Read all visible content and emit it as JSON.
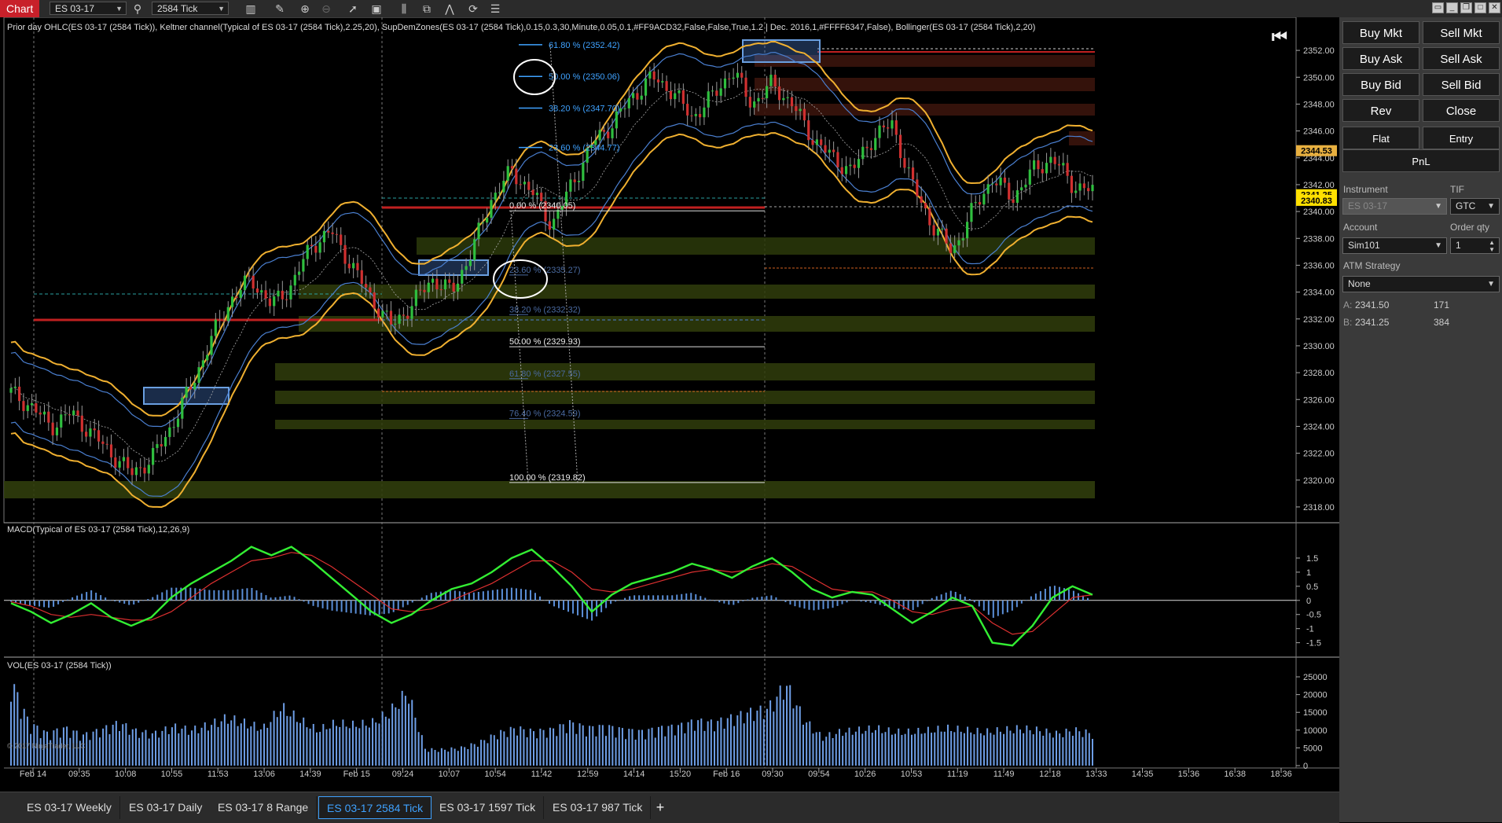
{
  "toolbar": {
    "title": "Chart",
    "instrument": "ES 03-17",
    "bar_type": "2584 Tick"
  },
  "chart_titles": {
    "price_panel": "Prior day OHLC(ES 03-17 (2584 Tick)), Keltner channel(Typical of ES 03-17 (2584 Tick),2.25,20), SupDemZones(ES 03-17 (2584 Tick),0.15,0.3,30,Minute,0.05,0.1,#FF9ACD32,False,False,True,1.2 | Dec. 2016,1,#FFFF6347,False), Bollinger(ES 03-17 (2584 Tick),2,20)",
    "macd_panel": "MACD(Typical of ES 03-17 (2584 Tick),12,26,9)",
    "vol_panel": "VOL(ES 03-17 (2584 Tick))",
    "copyright": "© 2017 NinjaTrader, LLC"
  },
  "chart_data": [
    {
      "type": "line",
      "panel": "price",
      "ylim": [
        2317.0,
        2353.0
      ],
      "y_ticks": [
        "2352.00",
        "2350.00",
        "2348.00",
        "2346.00",
        "2344.00",
        "2342.00",
        "2340.00",
        "2338.00",
        "2336.00",
        "2334.00",
        "2332.00",
        "2330.00",
        "2328.00",
        "2326.00",
        "2324.00",
        "2322.00",
        "2320.00",
        "2318.00"
      ],
      "x_ticks": [
        "Feb 14",
        "09:35",
        "10:08",
        "10:55",
        "11:53",
        "13:06",
        "14:39",
        "Feb 15",
        "09:24",
        "10:07",
        "10:54",
        "11:42",
        "12:59",
        "14:14",
        "15:20",
        "Feb 16",
        "09:30",
        "09:54",
        "10:26",
        "10:53",
        "11:19",
        "11:49",
        "12:18",
        "13:33",
        "14:35",
        "15:36",
        "16:38",
        "18:36"
      ],
      "series": [
        {
          "values": [
            2326.5,
            2325.5,
            2324.0,
            2325.0,
            2323.5,
            2322.0,
            2320.5,
            2321.5,
            2324.0,
            2327.0,
            2330.5,
            2333.5,
            2335.0,
            2333.0,
            2334.5,
            2337.5,
            2338.5,
            2336.0,
            2333.5,
            2331.5,
            2333.0,
            2335.0,
            2334.0,
            2337.0,
            2341.0,
            2343.0,
            2341.5,
            2339.0,
            2342.0,
            2345.0,
            2346.5,
            2348.5,
            2350.0,
            2349.0,
            2347.0,
            2348.5,
            2350.5,
            2348.0,
            2349.5,
            2348.0,
            2345.5,
            2344.0,
            2343.0,
            2345.5,
            2346.5,
            2342.0,
            2339.0,
            2337.0,
            2340.0,
            2342.5,
            2341.0,
            2343.0,
            2344.0,
            2342.0,
            2341.5
          ]
        }
      ],
      "price_markers": [
        {
          "label": "2344.53",
          "value": 2344.53,
          "color": "#e8b040"
        },
        {
          "label": "2341.25",
          "value": 2341.25,
          "color": "#ffe000"
        },
        {
          "label": "2340.83",
          "value": 2340.83,
          "color": "#ffe000"
        }
      ],
      "fibonacci_upper": [
        {
          "label": "61.80 % (2352.42)",
          "value": 2352.42
        },
        {
          "label": "50.00 % (2350.06)",
          "value": 2350.06
        },
        {
          "label": "38.20 % (2347.70)",
          "value": 2347.7
        },
        {
          "label": "23.60 % (2344.77)",
          "value": 2344.77
        }
      ],
      "fibonacci_lower": [
        {
          "label": "0.00 % (2340.05)",
          "value": 2340.05
        },
        {
          "label": "23.60 % (2335.27)",
          "value": 2335.27
        },
        {
          "label": "38.20 % (2332.32)",
          "value": 2332.32
        },
        {
          "label": "50.00 % (2329.93)",
          "value": 2329.93
        },
        {
          "label": "61.80 % (2327.55)",
          "value": 2327.55
        },
        {
          "label": "76.40 % (2324.59)",
          "value": 2324.59
        },
        {
          "label": "100.00 % (2319.82)",
          "value": 2319.82
        }
      ]
    },
    {
      "type": "line",
      "panel": "macd",
      "ylim": [
        -1.9,
        2.0
      ],
      "y_ticks": [
        "1.5",
        "1",
        "0.5",
        "0",
        "-0.5",
        "-1",
        "-1.5"
      ],
      "series": [
        {
          "values": [
            -0.1,
            -0.4,
            -0.8,
            -0.5,
            -0.1,
            -0.6,
            -0.9,
            -0.6,
            0.1,
            0.6,
            1.0,
            1.4,
            1.9,
            1.6,
            1.9,
            1.4,
            0.8,
            0.2,
            -0.4,
            -0.8,
            -0.5,
            0.0,
            0.4,
            0.6,
            1.0,
            1.5,
            1.8,
            1.2,
            0.5,
            -0.4,
            0.2,
            0.6,
            0.8,
            1.0,
            1.3,
            1.1,
            0.8,
            1.2,
            1.5,
            1.0,
            0.4,
            0.1,
            0.3,
            0.2,
            -0.3,
            -0.8,
            -0.4,
            0.1,
            -0.2,
            -1.5,
            -1.6,
            -0.9,
            0.1,
            0.5,
            0.2
          ]
        },
        {
          "values": [
            -0.05,
            -0.2,
            -0.5,
            -0.6,
            -0.5,
            -0.6,
            -0.7,
            -0.7,
            -0.4,
            0.1,
            0.6,
            1.0,
            1.4,
            1.5,
            1.7,
            1.6,
            1.2,
            0.7,
            0.2,
            -0.3,
            -0.4,
            -0.3,
            0.0,
            0.3,
            0.6,
            1.0,
            1.4,
            1.4,
            1.0,
            0.4,
            0.3,
            0.4,
            0.6,
            0.8,
            1.0,
            1.1,
            1.0,
            1.1,
            1.3,
            1.2,
            0.8,
            0.4,
            0.3,
            0.3,
            0.0,
            -0.4,
            -0.5,
            -0.3,
            -0.2,
            -0.8,
            -1.2,
            -1.1,
            -0.5,
            0.1,
            0.2
          ]
        }
      ]
    },
    {
      "type": "bar",
      "panel": "volume",
      "ylim": [
        0,
        27000
      ],
      "y_ticks": [
        "25000",
        "20000",
        "15000",
        "10000",
        "5000",
        "0"
      ],
      "values": [
        24000,
        12000,
        9000,
        10500,
        8500,
        10000,
        12000,
        9500,
        9000,
        11000,
        10000,
        11500,
        13500,
        12000,
        10500,
        16500,
        13000,
        10000,
        12000,
        11500,
        12000,
        15000,
        21000,
        4500,
        4500,
        5000,
        6500,
        9000,
        10500,
        9500,
        10000,
        12000,
        10500,
        11000,
        10000,
        9500,
        10500,
        11000,
        12500,
        12000,
        13500,
        15000,
        16000,
        23000,
        13000,
        8000,
        9500,
        10000,
        10500,
        9500,
        9500,
        10000,
        10500,
        10000,
        9500,
        10000,
        10500,
        10000,
        9000,
        10000,
        9000
      ]
    }
  ],
  "trade_panel": {
    "buy_mkt": "Buy Mkt",
    "sell_mkt": "Sell Mkt",
    "buy_ask": "Buy Ask",
    "sell_ask": "Sell Ask",
    "buy_bid": "Buy Bid",
    "sell_bid": "Sell Bid",
    "rev": "Rev",
    "close": "Close",
    "flat": "Flat",
    "entry": "Entry",
    "pnl": "PnL",
    "instrument_label": "Instrument",
    "instrument_value": "ES 03-17",
    "tif_label": "TIF",
    "tif_value": "GTC",
    "account_label": "Account",
    "account_value": "Sim101",
    "order_qty_label": "Order qty",
    "order_qty_value": "1",
    "atm_label": "ATM Strategy",
    "atm_value": "None",
    "ask_label": "A:",
    "ask_price": "2341.50",
    "ask_size": "171",
    "bid_label": "B:",
    "bid_price": "2341.25",
    "bid_size": "384"
  },
  "tabs": [
    "ES 03-17 Weekly",
    "ES 03-17 Daily",
    "ES 03-17 8 Range",
    "ES 03-17 2584 Tick",
    "ES 03-17 1597 Tick",
    "ES 03-17 987 Tick"
  ],
  "active_tab": "ES 03-17 2584 Tick",
  "colors": {
    "price_line": "#bbbbbb",
    "keltner": "#f0b030",
    "bollinger": "#4a7fd0",
    "macd_line": "#33ee33",
    "macd_signal": "#dd3030",
    "macd_hist": "#5b8fd8",
    "volume": "#6e9ee6",
    "fib_upper": "#3fa2ff",
    "demand_zone": "#3a4a10",
    "supply_zone": "#4a1a10",
    "active_tab": "#3fa2ff"
  }
}
